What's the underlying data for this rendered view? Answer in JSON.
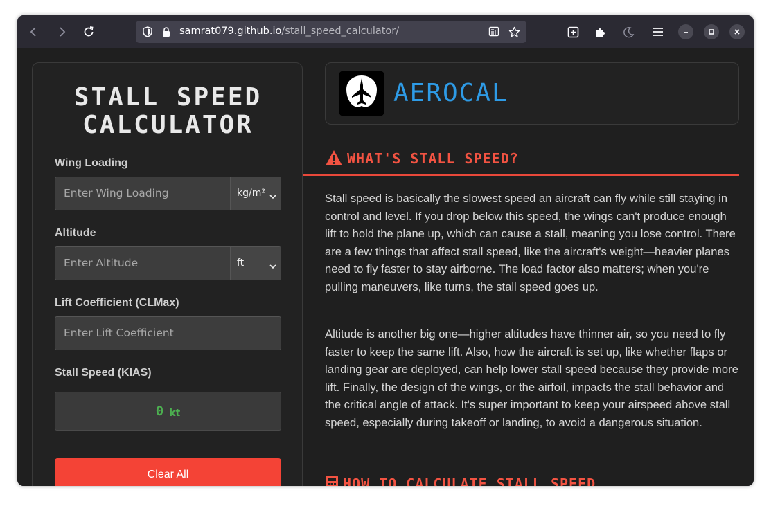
{
  "browser": {
    "url_domain": "samrat079.github.io",
    "url_path": "/stall_speed_calculator/"
  },
  "calculator": {
    "title_line1": "STALL SPEED",
    "title_line2": "CALCULATOR",
    "wing_loading": {
      "label": "Wing Loading",
      "placeholder": "Enter Wing Loading",
      "unit": "kg/m²"
    },
    "altitude": {
      "label": "Altitude",
      "placeholder": "Enter Altitude",
      "unit": "ft"
    },
    "lift_coefficient": {
      "label": "Lift Coefficient (CLMax)",
      "placeholder": "Enter Lift Coefficient"
    },
    "result": {
      "label": "Stall Speed (KIAS)",
      "value": "0",
      "unit": "kt"
    },
    "clear_label": "Clear All"
  },
  "brand": {
    "name": "AEROCAL"
  },
  "article": {
    "heading1": "WHAT'S STALL SPEED?",
    "para1": "Stall speed is basically the slowest speed an aircraft can fly while still staying in control and level. If you drop below this speed, the wings can't produce enough lift to hold the plane up, which can cause a stall, meaning you lose control. There are a few things that affect stall speed, like the aircraft's weight—heavier planes need to fly faster to stay airborne. The load factor also matters; when you're pulling maneuvers, like turns, the stall speed goes up.",
    "para2": "Altitude is another big one—higher altitudes have thinner air, so you need to fly faster to keep the same lift. Also, how the aircraft is set up, like whether flaps or landing gear are deployed, can help lower stall speed because they provide more lift. Finally, the design of the wings, or the airfoil, impacts the stall behavior and the critical angle of attack. It's super important to keep your airspeed above stall speed, especially during takeoff or landing, to avoid a dangerous situation.",
    "heading2": "HOW TO CALCULATE STALL SPEED"
  },
  "colors": {
    "accent_red": "#f44336",
    "brand_blue": "#2e9be6",
    "result_green": "#4caf50"
  }
}
